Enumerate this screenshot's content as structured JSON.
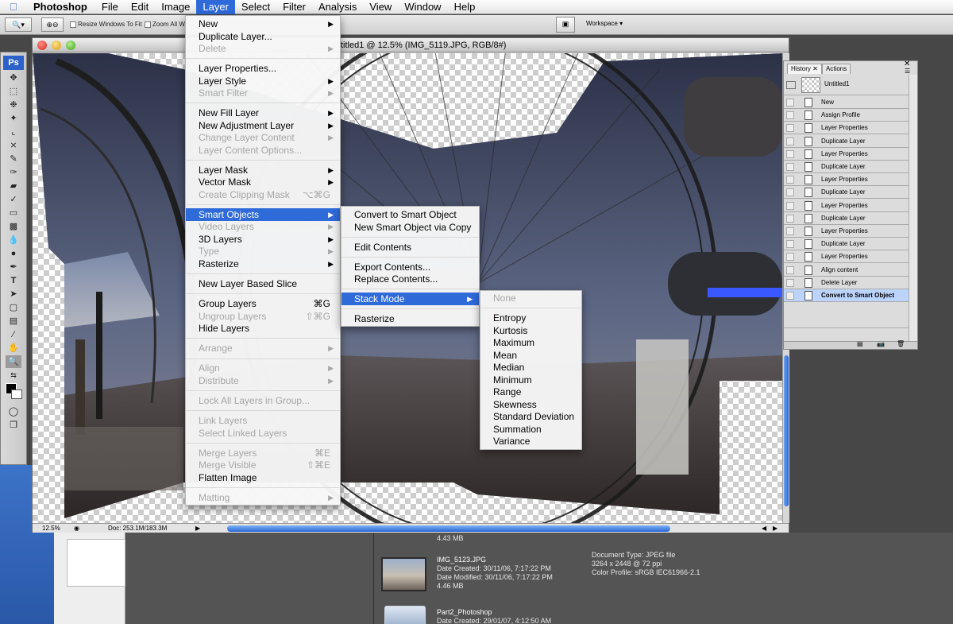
{
  "menubar": {
    "app": "Photoshop",
    "items": [
      "File",
      "Edit",
      "Image",
      "Layer",
      "Select",
      "Filter",
      "Analysis",
      "View",
      "Window",
      "Help"
    ]
  },
  "options": {
    "resize_label": "Resize Windows To Fit",
    "zoom_all_label": "Zoom All W",
    "workspace_label": "Workspace ▾"
  },
  "tools": {
    "logo": "Ps"
  },
  "document": {
    "title": "titled1 @ 12.5% (IMG_5119.JPG, RGB/8#)",
    "zoom": "12.5%",
    "doc_size": "Doc: 253.1M/183.3M"
  },
  "layer_menu": [
    {
      "label": "New",
      "submenu": true
    },
    {
      "label": "Duplicate Layer..."
    },
    {
      "label": "Delete",
      "disabled": true,
      "submenu": true
    },
    {
      "sep": true
    },
    {
      "label": "Layer Properties..."
    },
    {
      "label": "Layer Style",
      "submenu": true
    },
    {
      "label": "Smart Filter",
      "disabled": true,
      "submenu": true
    },
    {
      "sep": true
    },
    {
      "label": "New Fill Layer",
      "submenu": true
    },
    {
      "label": "New Adjustment Layer",
      "submenu": true
    },
    {
      "label": "Change Layer Content",
      "disabled": true,
      "submenu": true
    },
    {
      "label": "Layer Content Options...",
      "disabled": true
    },
    {
      "sep": true
    },
    {
      "label": "Layer Mask",
      "submenu": true
    },
    {
      "label": "Vector Mask",
      "submenu": true
    },
    {
      "label": "Create Clipping Mask",
      "disabled": true,
      "shortcut": "⌥⌘G"
    },
    {
      "sep": true
    },
    {
      "label": "Smart Objects",
      "submenu": true,
      "highlight": true
    },
    {
      "label": "Video Layers",
      "disabled": true,
      "submenu": true
    },
    {
      "label": "3D Layers",
      "submenu": true
    },
    {
      "label": "Type",
      "disabled": true,
      "submenu": true
    },
    {
      "label": "Rasterize",
      "submenu": true
    },
    {
      "sep": true
    },
    {
      "label": "New Layer Based Slice"
    },
    {
      "sep": true
    },
    {
      "label": "Group Layers",
      "shortcut": "⌘G"
    },
    {
      "label": "Ungroup Layers",
      "disabled": true,
      "shortcut": "⇧⌘G"
    },
    {
      "label": "Hide Layers"
    },
    {
      "sep": true
    },
    {
      "label": "Arrange",
      "disabled": true,
      "submenu": true
    },
    {
      "sep": true
    },
    {
      "label": "Align",
      "disabled": true,
      "submenu": true
    },
    {
      "label": "Distribute",
      "disabled": true,
      "submenu": true
    },
    {
      "sep": true
    },
    {
      "label": "Lock All Layers in Group...",
      "disabled": true
    },
    {
      "sep": true
    },
    {
      "label": "Link Layers",
      "disabled": true
    },
    {
      "label": "Select Linked Layers",
      "disabled": true
    },
    {
      "sep": true
    },
    {
      "label": "Merge Layers",
      "disabled": true,
      "shortcut": "⌘E"
    },
    {
      "label": "Merge Visible",
      "disabled": true,
      "shortcut": "⇧⌘E"
    },
    {
      "label": "Flatten Image"
    },
    {
      "sep": true
    },
    {
      "label": "Matting",
      "disabled": true,
      "submenu": true
    }
  ],
  "smart_menu": [
    {
      "label": "Convert to Smart Object"
    },
    {
      "label": "New Smart Object via Copy"
    },
    {
      "sep": true
    },
    {
      "label": "Edit Contents"
    },
    {
      "sep": true
    },
    {
      "label": "Export Contents..."
    },
    {
      "label": "Replace Contents..."
    },
    {
      "sep": true
    },
    {
      "label": "Stack Mode",
      "submenu": true,
      "highlight": true
    },
    {
      "sep": true
    },
    {
      "label": "Rasterize"
    }
  ],
  "stack_menu": [
    {
      "label": "None",
      "disabled": true
    },
    {
      "sep": true
    },
    {
      "label": "Entropy"
    },
    {
      "label": "Kurtosis"
    },
    {
      "label": "Maximum"
    },
    {
      "label": "Mean"
    },
    {
      "label": "Median"
    },
    {
      "label": "Minimum"
    },
    {
      "label": "Range"
    },
    {
      "label": "Skewness"
    },
    {
      "label": "Standard Deviation"
    },
    {
      "label": "Summation"
    },
    {
      "label": "Variance"
    }
  ],
  "history": {
    "tabs": [
      "History",
      "Actions"
    ],
    "snapshot": "Untitled1",
    "states": [
      "New",
      "Assign Profile",
      "Layer Properties",
      "Duplicate Layer",
      "Layer Properties",
      "Duplicate Layer",
      "Layer Properties",
      "Duplicate Layer",
      "Layer Properties",
      "Duplicate Layer",
      "Layer Properties",
      "Duplicate Layer",
      "Layer Properties",
      "Align content",
      "Delete Layer",
      "Convert to Smart Object"
    ]
  },
  "browser": {
    "prev_size": "4.43 MB",
    "file1_name": "IMG_5123.JPG",
    "file1_created": "Date Created: 30/11/06, 7:17:22 PM",
    "file1_modified": "Date Modified: 30/11/06, 7:17:22 PM",
    "file1_size": "4.46 MB",
    "file2_name": "Part2_Photoshop",
    "file2_created": "Date Created: 29/01/07, 4:12:50 AM",
    "meta_type": "Document Type: JPEG file",
    "meta_dims": "3264 x 2448 @ 72 ppi",
    "meta_profile": "Color Profile: sRGB IEC61966-2.1"
  }
}
